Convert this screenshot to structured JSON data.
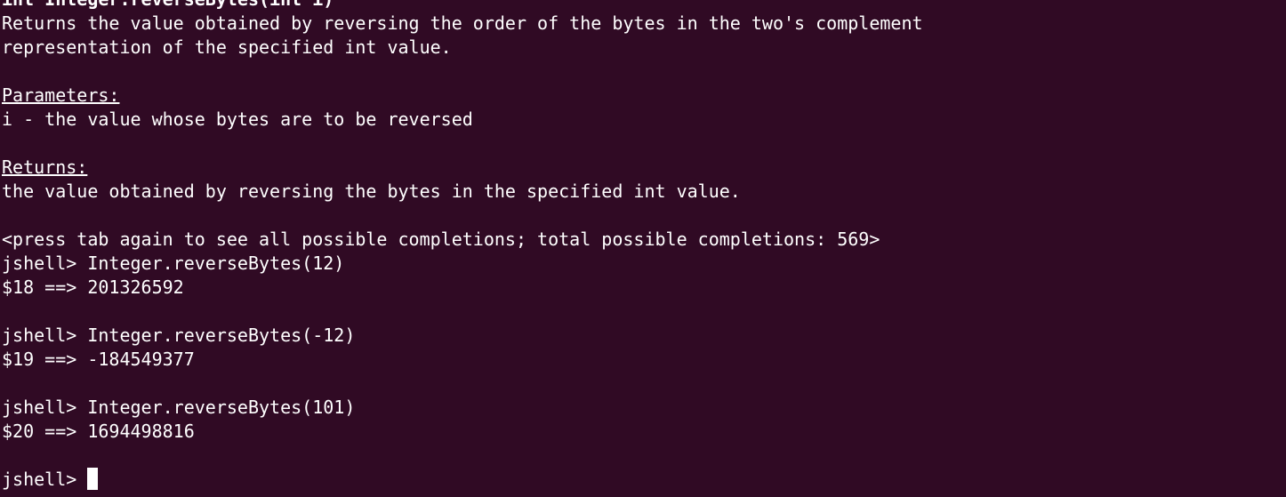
{
  "terminal": {
    "signature": "int Integer.reverseBytes(int i)",
    "description_line1": "Returns the value obtained by reversing the order of the bytes in the two's complement",
    "description_line2": "representation of the specified int value.",
    "parameters_heading": "Parameters:",
    "parameter_i": "i - the value whose bytes are to be reversed",
    "returns_heading": "Returns:",
    "returns_text": "the value obtained by reversing the bytes in the specified int value.",
    "completions_hint": "<press tab again to see all possible completions; total possible completions: 569>",
    "commands": [
      {
        "input": "jshell> Integer.reverseBytes(12)",
        "output": "$18 ==> 201326592"
      },
      {
        "input": "jshell> Integer.reverseBytes(-12)",
        "output": "$19 ==> -184549377"
      },
      {
        "input": "jshell> Integer.reverseBytes(101)",
        "output": "$20 ==> 1694498816"
      }
    ],
    "prompt": "jshell> "
  },
  "colors": {
    "background": "#300a24",
    "foreground": "#ffffff"
  }
}
